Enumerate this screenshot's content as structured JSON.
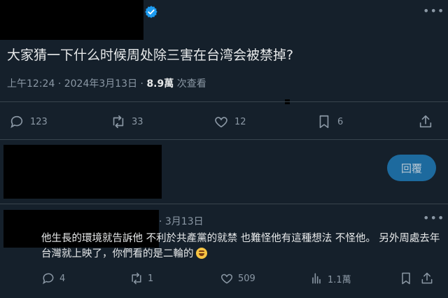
{
  "post": {
    "text": "大家猜一下什么时候周处除三害在台湾会被禁掉?",
    "time": "上午12:24",
    "separator": "·",
    "date": "2024年3月13日",
    "views_count": "8.9萬",
    "views_label": "次查看"
  },
  "actions": {
    "replies": "123",
    "reposts": "33",
    "likes": "12",
    "bookmarks": "6"
  },
  "compose": {
    "reply_button": "回覆"
  },
  "comment": {
    "date": "· 3月13日",
    "text": "他生長的環境就告訴他 不利於共產黨的就禁 也難怪他有這種想法 不怪他。 另外周處去年台灣就上映了，你們看的是二輪的",
    "replies": "4",
    "reposts": "1",
    "likes": "509",
    "views": "1.1萬"
  },
  "colors": {
    "background": "#15202b",
    "accent": "#1d9bf0",
    "muted": "#8b98a5"
  }
}
